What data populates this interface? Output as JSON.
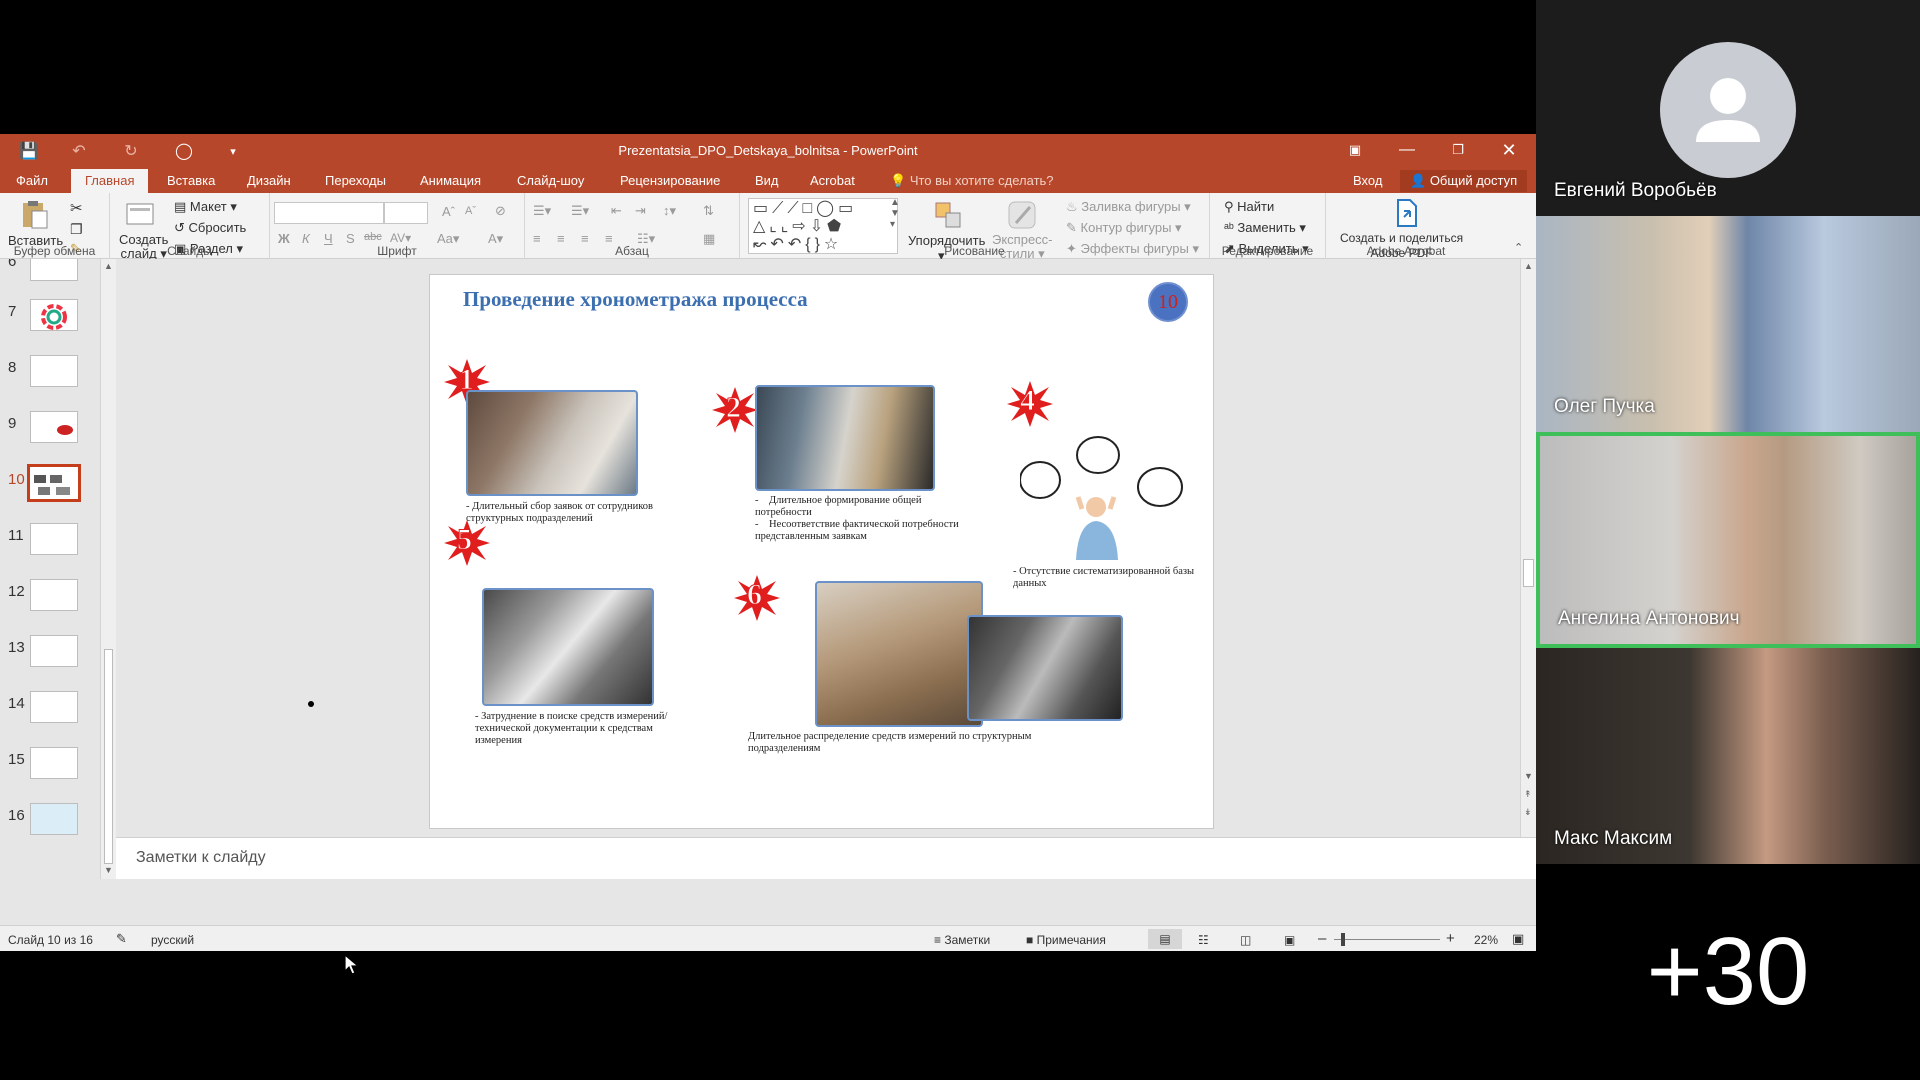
{
  "window": {
    "title": "Prezentatsia_DPO_Detskaya_bolnitsa - PowerPoint"
  },
  "tabs": [
    "Файл",
    "Главная",
    "Вставка",
    "Дизайн",
    "Переходы",
    "Анимация",
    "Слайд-шоу",
    "Рецензирование",
    "Вид",
    "Acrobat"
  ],
  "tell_me": "Что вы хотите сделать?",
  "account": {
    "signin": "Вход",
    "share": "Общий доступ"
  },
  "ribbon": {
    "clipboard": {
      "label": "Буфер обмена",
      "paste": "Вставить"
    },
    "slides": {
      "label": "Слайды",
      "new_slide_1": "Создать",
      "new_slide_2": "слайд",
      "layout": "Макет",
      "reset": "Сбросить",
      "section": "Раздел"
    },
    "font": {
      "label": "Шрифт"
    },
    "paragraph": {
      "label": "Абзац"
    },
    "drawing": {
      "label": "Рисование",
      "arrange": "Упорядочить",
      "quick_styles_1": "Экспресс-",
      "quick_styles_2": "стили",
      "fill": "Заливка фигуры",
      "outline": "Контур фигуры",
      "effects": "Эффекты фигуры"
    },
    "editing": {
      "label": "Редактирование",
      "find": "Найти",
      "replace": "Заменить",
      "select": "Выделить"
    },
    "acrobat": {
      "label": "Adobe Acrobat",
      "create_1": "Создать и поделиться",
      "create_2": "Adobe PDF"
    }
  },
  "thumbnails": [
    {
      "num": "6",
      "selected": false
    },
    {
      "num": "7",
      "selected": false
    },
    {
      "num": "8",
      "selected": false
    },
    {
      "num": "9",
      "selected": false
    },
    {
      "num": "10",
      "selected": true
    },
    {
      "num": "11",
      "selected": false
    },
    {
      "num": "12",
      "selected": false
    },
    {
      "num": "13",
      "selected": false
    },
    {
      "num": "14",
      "selected": false
    },
    {
      "num": "15",
      "selected": false
    },
    {
      "num": "16",
      "selected": false
    }
  ],
  "slide": {
    "title": "Проведение хронометража процесса",
    "number": "10",
    "steps": [
      "1",
      "2",
      "4",
      "5",
      "6"
    ],
    "captions": {
      "c1": "- Длительный сбор заявок от сотрудников структурных подразделений",
      "c2a": "Длительное формирование общей потребности",
      "c2b": "Несоответствие фактической потребности представленным заявкам",
      "c4": "- Отсутствие систематизированной базы данных",
      "c5": "- Затруднение в поиске средств измерений/технической документации к средствам измерения",
      "c6": "Длительное распределение средств измерений по структурным подразделениям"
    }
  },
  "notes_placeholder": "Заметки к слайду",
  "status": {
    "slide_counter": "Слайд 10 из 16",
    "language": "русский",
    "notes": "Заметки",
    "comments": "Примечания",
    "zoom": "22%"
  },
  "participants": [
    {
      "name": "Евгений Воробьёв",
      "video": false
    },
    {
      "name": "Олег Пучка",
      "video": true
    },
    {
      "name": "Ангелина Антонович",
      "video": true,
      "active_speaker": true
    },
    {
      "name": "Макс Максим",
      "video": true
    }
  ],
  "more_participants": "+30",
  "colors": {
    "accent": "#b7472a",
    "speaker_border": "#3fbf5a",
    "slide_title": "#3c6fb0"
  }
}
